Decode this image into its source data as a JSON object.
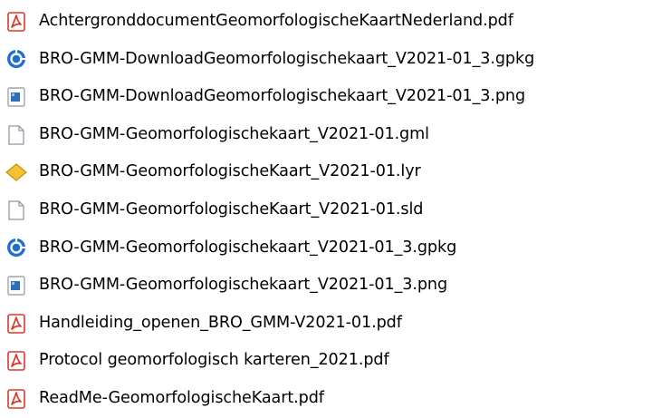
{
  "explorer": {
    "files": [
      {
        "name": "AchtergronddocumentGeomorfologischeKaartNederland.pdf",
        "icon": "pdf-icon"
      },
      {
        "name": "BRO-GMM-DownloadGeomorfologischekaart_V2021-01_3.gpkg",
        "icon": "gpkg-icon"
      },
      {
        "name": "BRO-GMM-DownloadGeomorfologischekaart_V2021-01_3.png",
        "icon": "png-image-icon"
      },
      {
        "name": "BRO-GMM-Geomorfologischekaart_V2021-01.gml",
        "icon": "blank-file-icon"
      },
      {
        "name": "BRO-GMM-GeomorfologischeKaart_V2021-01.lyr",
        "icon": "layer-file-icon"
      },
      {
        "name": "BRO-GMM-GeomorfologischeKaart_V2021-01.sld",
        "icon": "blank-file-icon"
      },
      {
        "name": "BRO-GMM-Geomorfologischekaart_V2021-01_3.gpkg",
        "icon": "gpkg-icon"
      },
      {
        "name": "BRO-GMM-Geomorfologischekaart_V2021-01_3.png",
        "icon": "png-image-icon"
      },
      {
        "name": "Handleiding_openen_BRO_GMM-V2021-01.pdf",
        "icon": "pdf-icon"
      },
      {
        "name": "Protocol geomorfologisch karteren_2021.pdf",
        "icon": "pdf-icon"
      },
      {
        "name": "ReadMe-GeomorfologischeKaart.pdf",
        "icon": "pdf-icon"
      }
    ]
  },
  "colors": {
    "pdf_red": "#d9392b",
    "gpkg_blue": "#1f6fd1",
    "png_blue": "#2f6fb5",
    "layer_yellow": "#f5c22f",
    "text": "#000000"
  }
}
